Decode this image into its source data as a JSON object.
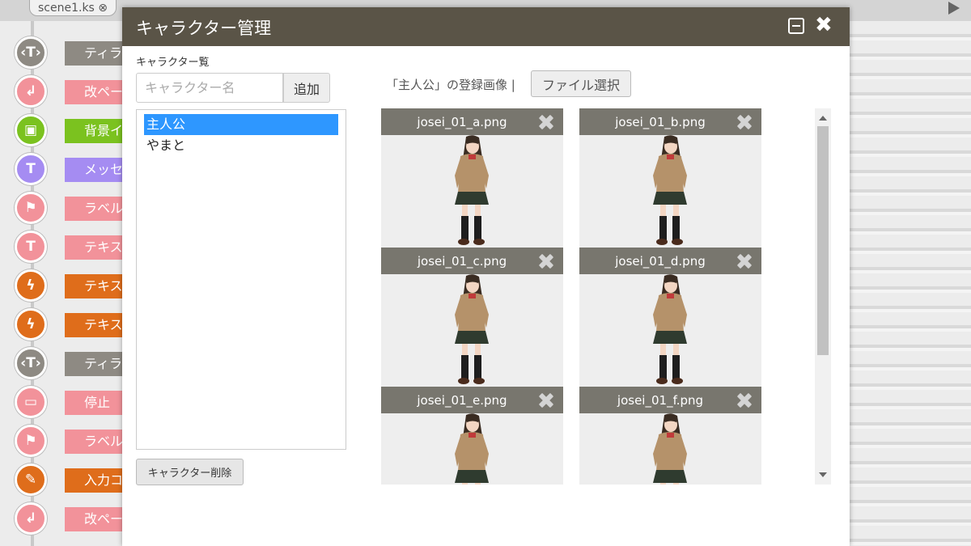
{
  "tab": {
    "label": "scene1.ks ⊗"
  },
  "timeline": [
    {
      "label": "ティラノ",
      "color": "#8e8a83",
      "glyph": "‹T›",
      "icon": "tag-icon"
    },
    {
      "label": "改ページ",
      "color": "#f2929a",
      "glyph": "↲",
      "icon": "page-break-icon"
    },
    {
      "label": "背景イメ",
      "color": "#7bc21f",
      "glyph": "▣",
      "icon": "background-image-icon"
    },
    {
      "label": "メッセー",
      "color": "#a58cf2",
      "glyph": "T",
      "icon": "message-icon"
    },
    {
      "label": "ラベル",
      "color": "#f2929a",
      "glyph": "⚑",
      "icon": "label-flag-icon"
    },
    {
      "label": "テキスト",
      "color": "#f2929a",
      "glyph": "T",
      "icon": "text-icon"
    },
    {
      "label": "テキスト",
      "color": "#df6d1b",
      "glyph": "ϟ",
      "icon": "lightning-icon"
    },
    {
      "label": "テキスト",
      "color": "#df6d1b",
      "glyph": "ϟ",
      "icon": "lightning-icon"
    },
    {
      "label": "ティラノ",
      "color": "#8e8a83",
      "glyph": "‹T›",
      "icon": "tag-icon"
    },
    {
      "label": "停止",
      "color": "#f2929a",
      "glyph": "▭",
      "icon": "stop-icon"
    },
    {
      "label": "ラベル",
      "color": "#f2929a",
      "glyph": "⚑",
      "icon": "label-flag-icon"
    },
    {
      "label": "入力コミ",
      "color": "#df6d1b",
      "glyph": "✎",
      "icon": "input-pen-icon"
    },
    {
      "label": "改ページ",
      "color": "#f2929a",
      "glyph": "↲",
      "icon": "page-break-icon"
    }
  ],
  "modal": {
    "title": "キャラクター管理",
    "list_heading": "キャラクター覧",
    "name_placeholder": "キャラクター名",
    "add_label": "追加",
    "characters": [
      {
        "name": "主人公",
        "selected": true
      },
      {
        "name": "やまと",
        "selected": false
      }
    ],
    "delete_label": "キャラクター削除",
    "images_heading": "「主人公」の登録画像 |",
    "file_select_label": "ファイル選択",
    "images": [
      {
        "filename": "josei_01_a.png"
      },
      {
        "filename": "josei_01_b.png"
      },
      {
        "filename": "josei_01_c.png"
      },
      {
        "filename": "josei_01_d.png"
      },
      {
        "filename": "josei_01_e.png"
      },
      {
        "filename": "josei_01_f.png"
      }
    ]
  },
  "colors": {
    "modal_header": "#5a5447",
    "card_header": "#78766e",
    "selection": "#2e97ff"
  }
}
